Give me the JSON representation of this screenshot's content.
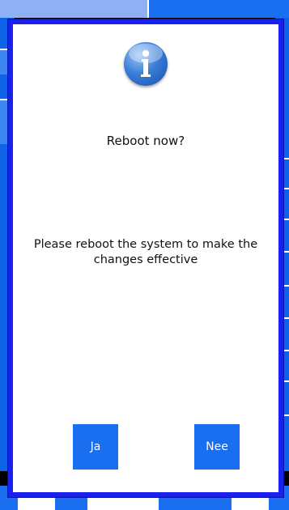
{
  "dialog": {
    "icon": "info-icon",
    "title": "Reboot now?",
    "message": "Please reboot the system to make the changes effective",
    "buttons": {
      "yes_label": "Ja",
      "no_label": "Nee"
    }
  },
  "colors": {
    "dialog_border": "#1a20ee",
    "button_bg": "#1a6ff0",
    "background_blue": "#0f63e8",
    "icon_blue": "#3a7ed8"
  }
}
